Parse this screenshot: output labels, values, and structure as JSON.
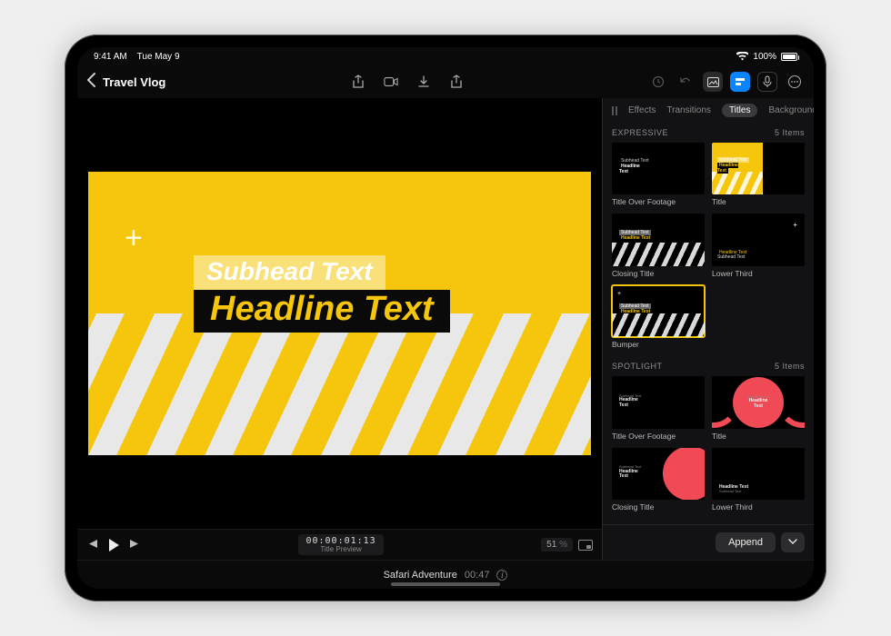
{
  "status": {
    "time": "9:41 AM",
    "date": "Tue May 9",
    "battery_pct": "100%"
  },
  "navbar": {
    "project_title": "Travel Vlog"
  },
  "preview": {
    "subhead": "Subhead Text",
    "headline": "Headline Text",
    "accent_color": "#f5c60c"
  },
  "transport": {
    "timecode": "00:00:01:13",
    "timecode_label": "Title Preview",
    "zoom_value": "51",
    "zoom_unit": "%"
  },
  "bottom": {
    "clip_name": "Safari Adventure",
    "clip_duration": "00:47"
  },
  "browser": {
    "tabs": {
      "effects": "Effects",
      "transitions": "Transitions",
      "titles": "Titles",
      "backgrounds": "Backgrounds"
    },
    "active_tab": "Titles",
    "sections": [
      {
        "name": "EXPRESSIVE",
        "count": "5 Items",
        "items": [
          {
            "label": "Title Over Footage"
          },
          {
            "label": "Title"
          },
          {
            "label": "Closing Title"
          },
          {
            "label": "Lower Third"
          },
          {
            "label": "Bumper"
          }
        ]
      },
      {
        "name": "SPOTLIGHT",
        "count": "5 Items",
        "items": [
          {
            "label": "Title Over Footage"
          },
          {
            "label": "Title"
          },
          {
            "label": "Closing Title"
          },
          {
            "label": "Lower Third"
          }
        ]
      }
    ],
    "append_label": "Append"
  }
}
